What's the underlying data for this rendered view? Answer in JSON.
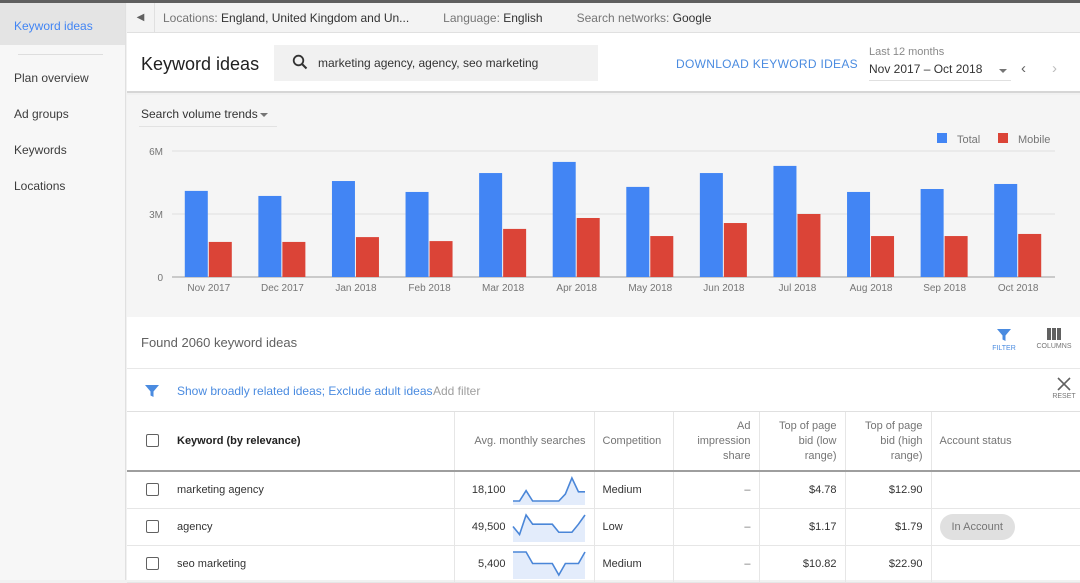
{
  "sidebar": {
    "active": "Keyword ideas",
    "items": [
      {
        "label": "Plan overview"
      },
      {
        "label": "Ad groups"
      },
      {
        "label": "Keywords"
      },
      {
        "label": "Locations"
      }
    ]
  },
  "crumbs": {
    "locations_label": "Locations:",
    "locations_value": "England, United Kingdom and Un...",
    "language_label": "Language:",
    "language_value": "English",
    "networks_label": "Search networks:",
    "networks_value": "Google"
  },
  "header": {
    "title": "Keyword ideas",
    "search_value": "marketing agency, agency, seo marketing",
    "download_label": "DOWNLOAD KEYWORD IDEAS",
    "range_label": "Last 12 months",
    "range_value": "Nov 2017 – Oct 2018"
  },
  "chart_section": {
    "selector_label": "Search volume trends"
  },
  "chart_data": {
    "type": "bar",
    "title": "Search volume trends",
    "categories": [
      "Nov 2017",
      "Dec 2017",
      "Jan 2018",
      "Feb 2018",
      "Mar 2018",
      "Apr 2018",
      "May 2018",
      "Jun 2018",
      "Jul 2018",
      "Aug 2018",
      "Sep 2018",
      "Oct 2018"
    ],
    "series": [
      {
        "name": "Total",
        "color": "#4285f4",
        "values": [
          4.1,
          3.86,
          4.57,
          4.05,
          4.95,
          5.48,
          4.29,
          4.95,
          5.29,
          4.05,
          4.19,
          4.43
        ]
      },
      {
        "name": "Mobile",
        "color": "#db4437",
        "values": [
          1.67,
          1.67,
          1.9,
          1.71,
          2.29,
          2.81,
          1.95,
          2.57,
          3.0,
          1.95,
          1.95,
          2.05
        ]
      }
    ],
    "value_unit": "M",
    "yticks": [
      {
        "value": 0,
        "label": "0"
      },
      {
        "value": 3,
        "label": "3M"
      },
      {
        "value": 6,
        "label": "6M"
      }
    ],
    "ylim": [
      0,
      6
    ],
    "grid": true,
    "legend_position": "top-right",
    "xlabel": "",
    "ylabel": ""
  },
  "results": {
    "found_text": "Found 2060 keyword ideas",
    "filter_label": "FILTER",
    "columns_label": "COLUMNS",
    "filter_text": "Show broadly related ideas; Exclude adult ideas",
    "add_filter": "Add filter",
    "reset_label": "RESET",
    "accent": "#4a8be0"
  },
  "table": {
    "headers": {
      "keyword": "Keyword (by relevance)",
      "searches": "Avg. monthly searches",
      "competition": "Competition",
      "impression": "Ad impression share",
      "bid_low": "Top of page bid (low range)",
      "bid_high": "Top of page bid (high range)",
      "status": "Account status"
    },
    "rows": [
      {
        "keyword": "marketing agency",
        "searches": "18,100",
        "trend": [
          0,
          0,
          0.45,
          0,
          0,
          0,
          0,
          0,
          0.3,
          1,
          0.4,
          0.4
        ],
        "competition": "Medium",
        "impression": "–",
        "bid_low": "$4.78",
        "bid_high": "$12.90",
        "status": ""
      },
      {
        "keyword": "agency",
        "searches": "49,500",
        "trend": [
          0.5,
          0.15,
          1,
          0.6,
          0.6,
          0.6,
          0.6,
          0.25,
          0.25,
          0.25,
          0.6,
          1
        ],
        "competition": "Low",
        "impression": "–",
        "bid_low": "$1.17",
        "bid_high": "$1.79",
        "status": "In Account"
      },
      {
        "keyword": "seo marketing",
        "searches": "5,400",
        "trend": [
          1,
          1,
          1,
          0.5,
          0.5,
          0.5,
          0.5,
          0,
          0.5,
          0.5,
          0.5,
          1
        ],
        "competition": "Medium",
        "impression": "–",
        "bid_low": "$10.82",
        "bid_high": "$22.90",
        "status": ""
      }
    ]
  }
}
